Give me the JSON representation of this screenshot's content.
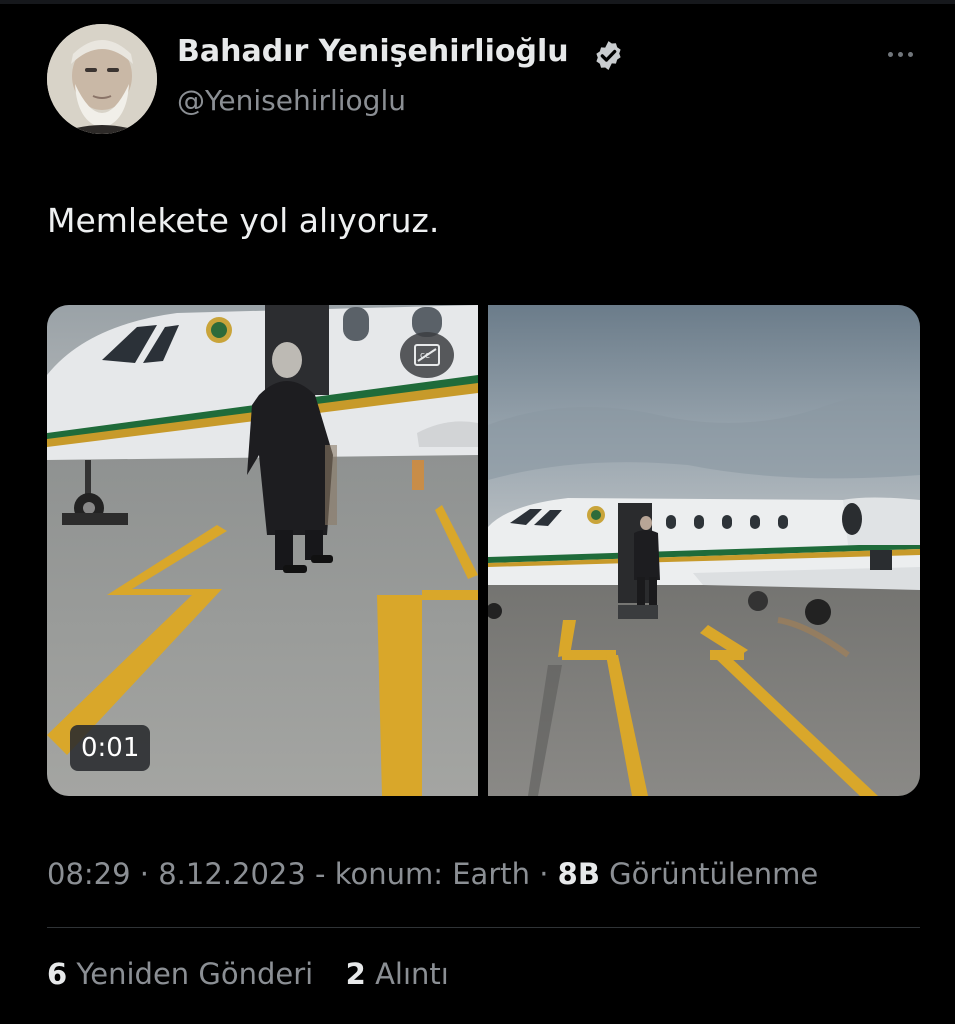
{
  "author": {
    "display_name": "Bahadır Yenişehirlioğlu",
    "handle": "@Yenisehirlioglu",
    "verified": true,
    "avatar_icon": "portrait-photo"
  },
  "tweet": {
    "text": "Memlekete yol alıyoruz."
  },
  "media": {
    "video": {
      "duration": "0:01",
      "badge_icon": "gif-badge-icon",
      "description_icon": "jet-boarding-video"
    },
    "photo": {
      "description_icon": "jet-on-tarmac-photo"
    }
  },
  "meta": {
    "time": "08:29",
    "sep1": " · ",
    "date": "8.12.2023",
    "location_text": " - konum: Earth",
    "sep2": " · ",
    "views_count": "8B",
    "views_label": " Görüntülenme"
  },
  "stats": {
    "reposts_count": "6",
    "reposts_label": " Yeniden Gönderi",
    "quotes_count": "2",
    "quotes_label": " Alıntı"
  },
  "colors": {
    "background": "#000000",
    "text_primary": "#e7e9ea",
    "text_secondary": "#8b8f94",
    "divider": "#2f3336"
  }
}
